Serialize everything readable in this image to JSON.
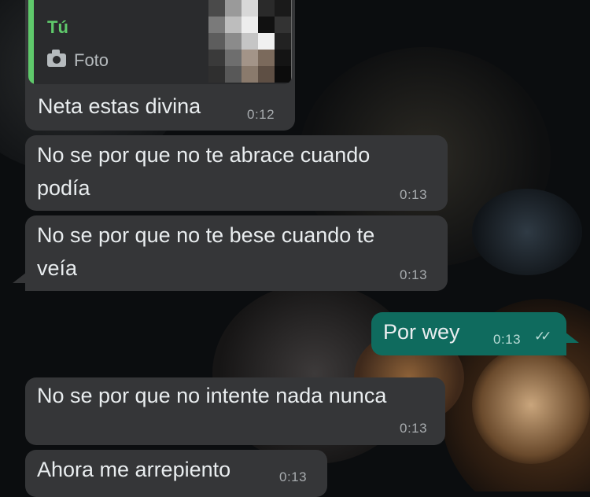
{
  "messages": [
    {
      "direction": "incoming",
      "quote": {
        "author": "Tú",
        "icon": "camera-icon",
        "type_label": "Foto"
      },
      "text": "Neta estas divina",
      "time": "0:12"
    },
    {
      "direction": "incoming",
      "text_lines": [
        "No se por que no te abrace cuando",
        "podía"
      ],
      "time": "0:13"
    },
    {
      "direction": "incoming",
      "text_lines": [
        "No se por que no te bese cuando te",
        "veía"
      ],
      "time": "0:13"
    },
    {
      "direction": "outgoing",
      "text": "Por wey",
      "time": "0:13",
      "status_icon": "double-check-icon"
    },
    {
      "direction": "incoming",
      "text": "No se por que no intente nada nunca",
      "time": "0:13"
    },
    {
      "direction": "incoming",
      "text": "Ahora me arrepiento",
      "time": "0:13"
    }
  ],
  "colors": {
    "incoming_bubble": "#353638",
    "outgoing_bubble": "#0f6b5e",
    "quote_accent": "#5fc96b",
    "text": "#e9edef"
  }
}
